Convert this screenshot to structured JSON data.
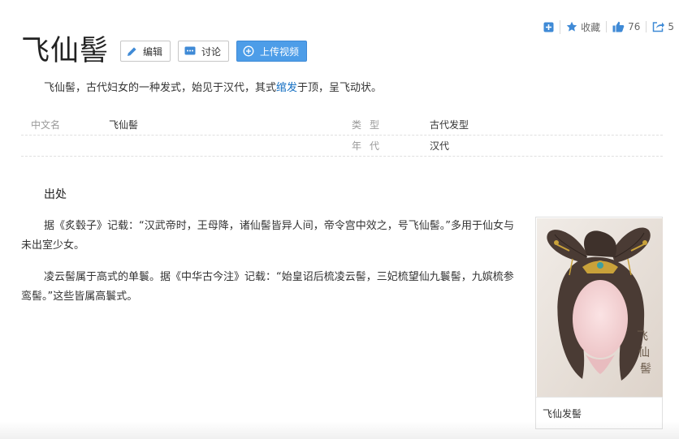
{
  "toolbar": {
    "add_icon": "plus-square-icon",
    "favorite_label": "收藏",
    "like_count": "76",
    "share_count": "5"
  },
  "entry": {
    "title": "飞仙髻",
    "buttons": {
      "edit": "编辑",
      "discuss": "讨论",
      "upload_video": "上传视频"
    }
  },
  "summary": {
    "before": "飞仙髻，古代妇女的一种发式，始见于汉代，其式",
    "link": "绾发",
    "after": "于顶，呈飞动状。"
  },
  "basic_info": {
    "left": [
      {
        "key": "中文名",
        "value": "飞仙髻"
      }
    ],
    "right": [
      {
        "key": "类型",
        "value": "古代发型"
      },
      {
        "key": "年代",
        "value": "汉代"
      }
    ]
  },
  "section": {
    "title": "出处",
    "paragraphs": [
      "据《炙毂子》记载：“汉武帝时，王母降，诸仙髻皆异人间，帝令宫中效之，号飞仙髻。”多用于仙女与未出室少女。",
      "凌云髻属于高式的单鬟。据《中华古今注》记载：“始皇诏后梳凌云髻，三妃梳望仙九鬟髻，九嫔梳参鸾髻。”这些皆属高鬟式。"
    ]
  },
  "figure": {
    "caption": "飞仙发髻",
    "image_text": "飞仙髻"
  },
  "colors": {
    "accent": "#4d9de8",
    "link": "#136ec2"
  }
}
